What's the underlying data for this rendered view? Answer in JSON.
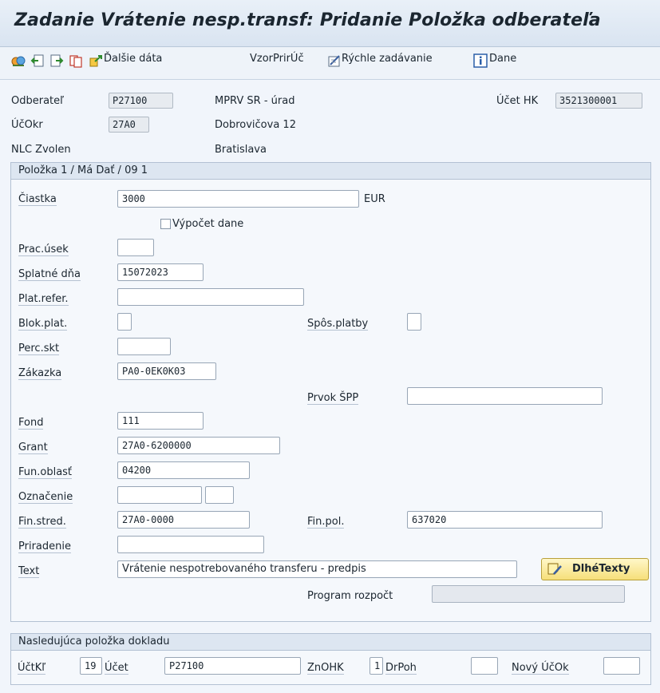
{
  "window": {
    "title": "Zadanie Vrátenie nesp.transf: Pridanie Položka odberateľa"
  },
  "toolbar": {
    "icons": [
      "overview-icon",
      "previous-icon",
      "next-icon",
      "copy-icon",
      "more-data-icon"
    ],
    "dalsie_data": "Ďalšie dáta",
    "vzor": "VzorPrirÚč",
    "rychle": "Rýchle zadávanie",
    "dane": "Dane"
  },
  "header": {
    "odberatel_label": "Odberateľ",
    "odberatel_value": "P27100",
    "ucokr_label": "ÚčOkr",
    "ucokr_value": "27A0",
    "name_line1": "MPRV SR - úrad",
    "name_line2": "Dobrovičova 12",
    "name_line3": "Bratislava",
    "company": "NLC Zvolen",
    "ucet_hk_label": "Účet HK",
    "ucet_hk_value": "3521300001"
  },
  "item": {
    "group_title": "Položka 1 / Má Dať / 09 1",
    "ciastka_label": "Čiastka",
    "ciastka_value": "3000",
    "currency": "EUR",
    "vypocet_dane": "Výpočet dane",
    "prac_usek_label": "Prac.úsek",
    "prac_usek_value": "",
    "splatne_label": "Splatné dňa",
    "splatne_value": "15072023",
    "plat_refer_label": "Plat.refer.",
    "plat_refer_value": "",
    "blok_plat_label": "Blok.plat.",
    "spos_platby_label": "Spôs.platby",
    "perc_skt_label": "Perc.skt",
    "zakazka_label": "Zákazka",
    "zakazka_value": "PA0-0EK0K03",
    "prvok_spp_label": "Prvok ŠPP",
    "prvok_spp_value": "",
    "fond_label": "Fond",
    "fond_value": "111",
    "grant_label": "Grant",
    "grant_value": "27A0-6200000",
    "fun_oblast_label": "Fun.oblasť",
    "fun_oblast_value": "04200",
    "oznacenie_label": "Označenie",
    "fin_stred_label": "Fin.stred.",
    "fin_stred_value": "27A0-0000",
    "fin_pol_label": "Fin.pol.",
    "fin_pol_value": "637020",
    "priradenie_label": "Priradenie",
    "text_label": "Text",
    "text_value": "Vrátenie nespotrebovaného transferu - predpis",
    "dlhe_texty": "DlhéTexty",
    "program_label": "Program rozpočt"
  },
  "next_item": {
    "group_title": "Nasledujúca položka dokladu",
    "ucktl_label": "ÚčtKľ",
    "ucktl_value": "19",
    "ucet_label": "Účet",
    "ucet_value": "P27100",
    "znohk_label": "ZnOHK",
    "znohk_value": "1",
    "drpoh_label": "DrPoh",
    "novy_ucok_label": "Nový ÚčOk"
  }
}
